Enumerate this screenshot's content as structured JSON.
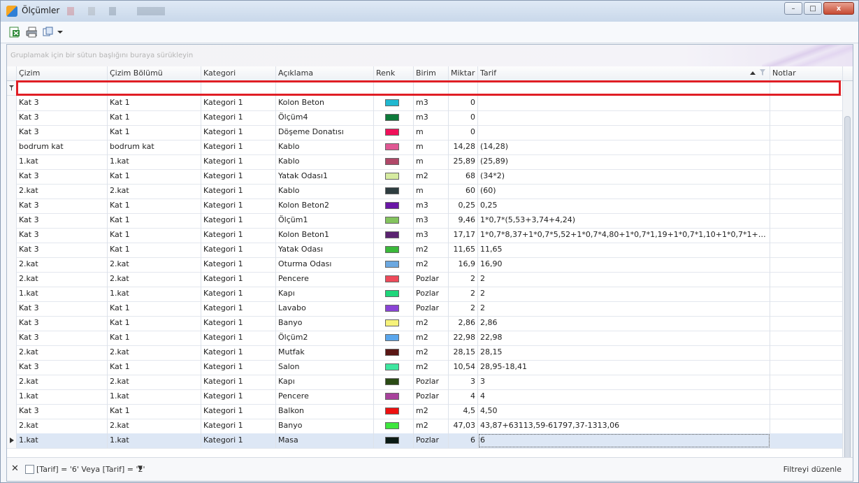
{
  "window": {
    "title": "Ölçümler"
  },
  "window_buttons": {
    "minimize": "–",
    "maximize": "□",
    "close": "x"
  },
  "toolbar": {
    "excel_icon": "excel-export-icon",
    "print_icon": "print-icon",
    "copy_icon": "copy-icon",
    "dropdown_icon": "chevron-down-icon"
  },
  "group_panel": {
    "hint": "Gruplamak için bir sütun başlığını buraya sürükleyin"
  },
  "columns": [
    {
      "key": "cizim",
      "label": "Çizim"
    },
    {
      "key": "bolum",
      "label": "Çizim Bölümü"
    },
    {
      "key": "kategori",
      "label": "Kategori"
    },
    {
      "key": "aciklama",
      "label": "Açıklama"
    },
    {
      "key": "renk",
      "label": "Renk"
    },
    {
      "key": "birim",
      "label": "Birim"
    },
    {
      "key": "miktar",
      "label": "Miktar"
    },
    {
      "key": "tarif",
      "label": "Tarif"
    },
    {
      "key": "notlar",
      "label": "Notlar"
    }
  ],
  "rows": [
    {
      "cizim": "Kat 3",
      "bolum": "Kat 1",
      "kategori": "Kategori 1",
      "aciklama": "Kolon Beton",
      "renk": "#20b8d0",
      "birim": "m3",
      "miktar": "0",
      "tarif": "",
      "notlar": ""
    },
    {
      "cizim": "Kat 3",
      "bolum": "Kat 1",
      "kategori": "Kategori 1",
      "aciklama": "Ölçüm4",
      "renk": "#0e7a3a",
      "birim": "m3",
      "miktar": "0",
      "tarif": "",
      "notlar": ""
    },
    {
      "cizim": "Kat 3",
      "bolum": "Kat 1",
      "kategori": "Kategori 1",
      "aciklama": "Döşeme Donatısı",
      "renk": "#f0105a",
      "birim": "m",
      "miktar": "0",
      "tarif": "",
      "notlar": ""
    },
    {
      "cizim": "bodrum kat",
      "bolum": "bodrum kat",
      "kategori": "Kategori 1",
      "aciklama": "Kablo",
      "renk": "#e05894",
      "birim": "m",
      "miktar": "14,28",
      "tarif": "(14,28)",
      "notlar": ""
    },
    {
      "cizim": "1.kat",
      "bolum": "1.kat",
      "kategori": "Kategori 1",
      "aciklama": "Kablo",
      "renk": "#b04868",
      "birim": "m",
      "miktar": "25,89",
      "tarif": "(25,89)",
      "notlar": ""
    },
    {
      "cizim": "Kat 3",
      "bolum": "Kat 1",
      "kategori": "Kategori 1",
      "aciklama": "Yatak Odası1",
      "renk": "#d6eba0",
      "birim": "m2",
      "miktar": "68",
      "tarif": "(34*2)",
      "notlar": ""
    },
    {
      "cizim": "2.kat",
      "bolum": "2.kat",
      "kategori": "Kategori 1",
      "aciklama": "Kablo",
      "renk": "#2e3d40",
      "birim": "m",
      "miktar": "60",
      "tarif": "(60)",
      "notlar": ""
    },
    {
      "cizim": "Kat 3",
      "bolum": "Kat 1",
      "kategori": "Kategori 1",
      "aciklama": "Kolon Beton2",
      "renk": "#6a16a6",
      "birim": "m3",
      "miktar": "0,25",
      "tarif": "0,25",
      "notlar": ""
    },
    {
      "cizim": "Kat 3",
      "bolum": "Kat 1",
      "kategori": "Kategori 1",
      "aciklama": "Ölçüm1",
      "renk": "#84c45e",
      "birim": "m3",
      "miktar": "9,46",
      "tarif": "1*0,7*(5,53+3,74+4,24)",
      "notlar": ""
    },
    {
      "cizim": "Kat 3",
      "bolum": "Kat 1",
      "kategori": "Kategori 1",
      "aciklama": "Kolon Beton1",
      "renk": "#5a2370",
      "birim": "m3",
      "miktar": "17,17",
      "tarif": "1*0,7*8,37+1*0,7*5,52+1*0,7*4,80+1*0,7*1,19+1*0,7*1,10+1*0,7*1+1*0,7...",
      "notlar": ""
    },
    {
      "cizim": "Kat 3",
      "bolum": "Kat 1",
      "kategori": "Kategori 1",
      "aciklama": "Yatak Odası",
      "renk": "#3ab83a",
      "birim": "m2",
      "miktar": "11,65",
      "tarif": "11,65",
      "notlar": ""
    },
    {
      "cizim": "2.kat",
      "bolum": "2.kat",
      "kategori": "Kategori 1",
      "aciklama": "Oturma Odası",
      "renk": "#6ca8e0",
      "birim": "m2",
      "miktar": "16,9",
      "tarif": "16,90",
      "notlar": ""
    },
    {
      "cizim": "2.kat",
      "bolum": "2.kat",
      "kategori": "Kategori 1",
      "aciklama": "Pencere",
      "renk": "#ee4a5a",
      "birim": "Pozlar",
      "miktar": "2",
      "tarif": "2",
      "notlar": ""
    },
    {
      "cizim": "1.kat",
      "bolum": "1.kat",
      "kategori": "Kategori 1",
      "aciklama": "Kapı",
      "renk": "#1ed67a",
      "birim": "Pozlar",
      "miktar": "2",
      "tarif": "2",
      "notlar": ""
    },
    {
      "cizim": "Kat 3",
      "bolum": "Kat 1",
      "kategori": "Kategori 1",
      "aciklama": "Lavabo",
      "renk": "#8a44d6",
      "birim": "Pozlar",
      "miktar": "2",
      "tarif": "2",
      "notlar": ""
    },
    {
      "cizim": "Kat 3",
      "bolum": "Kat 1",
      "kategori": "Kategori 1",
      "aciklama": "Banyo",
      "renk": "#f6f27a",
      "birim": "m2",
      "miktar": "2,86",
      "tarif": "2,86",
      "notlar": ""
    },
    {
      "cizim": "Kat 3",
      "bolum": "Kat 1",
      "kategori": "Kategori 1",
      "aciklama": "Ölçüm2",
      "renk": "#5aa6ec",
      "birim": "m2",
      "miktar": "22,98",
      "tarif": "22,98",
      "notlar": ""
    },
    {
      "cizim": "2.kat",
      "bolum": "2.kat",
      "kategori": "Kategori 1",
      "aciklama": "Mutfak",
      "renk": "#5a1614",
      "birim": "m2",
      "miktar": "28,15",
      "tarif": "28,15",
      "notlar": ""
    },
    {
      "cizim": "Kat 3",
      "bolum": "Kat 1",
      "kategori": "Kategori 1",
      "aciklama": "Salon",
      "renk": "#3ee6a0",
      "birim": "m2",
      "miktar": "10,54",
      "tarif": "28,95-18,41",
      "notlar": ""
    },
    {
      "cizim": "2.kat",
      "bolum": "2.kat",
      "kategori": "Kategori 1",
      "aciklama": "Kapı",
      "renk": "#2a4a14",
      "birim": "Pozlar",
      "miktar": "3",
      "tarif": "3",
      "notlar": ""
    },
    {
      "cizim": "1.kat",
      "bolum": "1.kat",
      "kategori": "Kategori 1",
      "aciklama": "Pencere",
      "renk": "#a8429c",
      "birim": "Pozlar",
      "miktar": "4",
      "tarif": "4",
      "notlar": ""
    },
    {
      "cizim": "Kat 3",
      "bolum": "Kat 1",
      "kategori": "Kategori 1",
      "aciklama": "Balkon",
      "renk": "#ee1010",
      "birim": "m2",
      "miktar": "4,5",
      "tarif": "4,50",
      "notlar": ""
    },
    {
      "cizim": "2.kat",
      "bolum": "2.kat",
      "kategori": "Kategori 1",
      "aciklama": "Banyo",
      "renk": "#3ee63e",
      "birim": "m2",
      "miktar": "47,03",
      "tarif": "43,87+63113,59-61797,37-1313,06",
      "notlar": ""
    },
    {
      "cizim": "1.kat",
      "bolum": "1.kat",
      "kategori": "Kategori 1",
      "aciklama": "Masa",
      "renk": "#0a1a14",
      "birim": "Pozlar",
      "miktar": "6",
      "tarif": "6",
      "notlar": ""
    }
  ],
  "selected_row": 23,
  "footer": {
    "filter_text": "[Tarif] = '6' Veya [Tarif] = '2'",
    "edit_filter": "Filtreyi düzenle"
  }
}
